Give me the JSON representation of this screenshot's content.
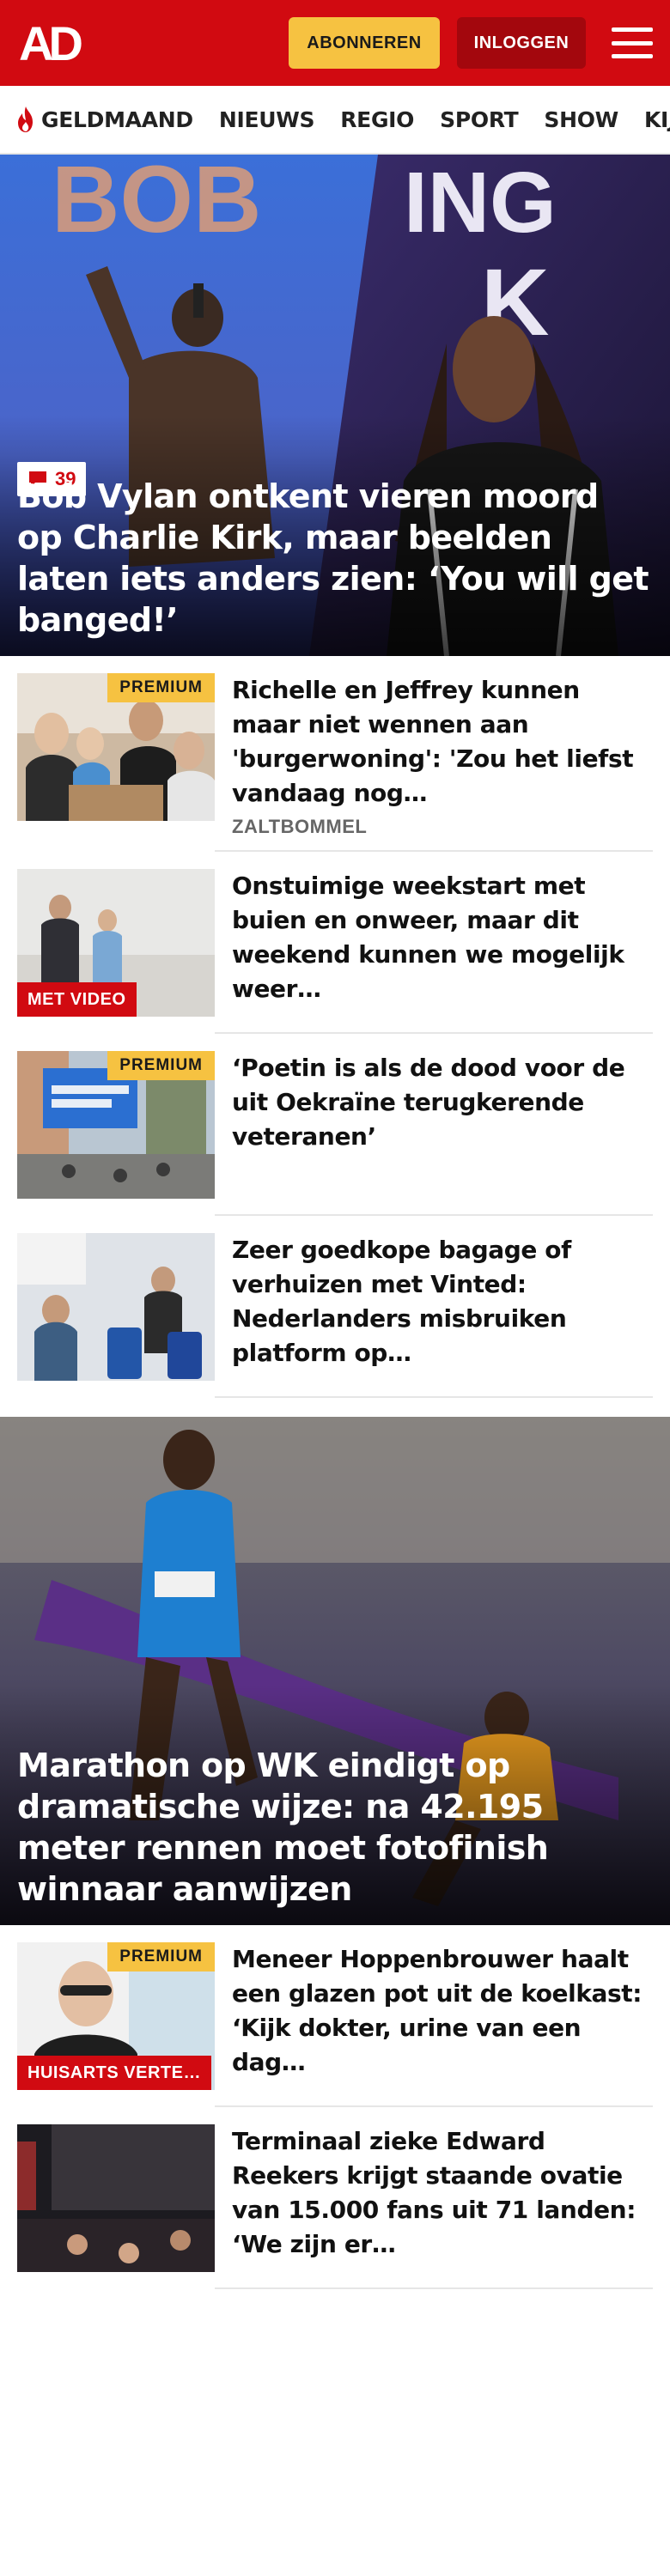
{
  "header": {
    "logo_text": "AD",
    "subscribe_label": "ABONNEREN",
    "login_label": "INLOGGEN",
    "menu_icon": "hamburger-icon",
    "brand_color": "#d10a11",
    "accent_color": "#f6c241"
  },
  "nav": {
    "items": [
      {
        "label": "GELDMAAND",
        "icon": "flame-icon"
      },
      {
        "label": "NIEUWS"
      },
      {
        "label": "REGIO"
      },
      {
        "label": "SPORT"
      },
      {
        "label": "SHOW"
      },
      {
        "label": "KIJK"
      }
    ]
  },
  "hero": {
    "comment_count": "39",
    "comment_icon": "comment-icon",
    "title": "Bob Vylan ontkent vieren moord op Charlie Kirk, maar beelden laten iets anders zien: ‘You will get banged!’"
  },
  "articles_top": [
    {
      "headline": "Richelle en Jeffrey kunnen maar niet wennen aan 'burgerwoning': 'Zou het liefst vandaag nog…",
      "location": "ZALTBOMMEL",
      "premium": "PREMIUM"
    },
    {
      "headline": "Onstuimige weekstart met buien en onweer, maar dit weekend kunnen we mogelijk weer…",
      "label": "MET VIDEO"
    },
    {
      "headline": "‘Poetin is als de dood voor de uit Oekraïne terugkerende veteranen’",
      "premium": "PREMIUM"
    },
    {
      "headline": "Zeer goedkope bagage of verhuizen met Vinted: Nederlanders misbruiken platform op…"
    }
  ],
  "hero2": {
    "title": "Marathon op WK eindigt op dramatische wijze: na 42.195 meter rennen moet fotofinish winnaar aanwijzen"
  },
  "articles_bottom": [
    {
      "headline": "Meneer Hoppenbrouwer haalt een glazen pot uit de koelkast: ‘Kijk dokter, urine van een dag…",
      "premium": "PREMIUM",
      "label": "HUISARTS VERTE…"
    },
    {
      "headline": "Terminaal zieke Edward Reekers krijgt staande ovatie van 15.000 fans uit 71 landen: ‘We zijn er…"
    }
  ]
}
